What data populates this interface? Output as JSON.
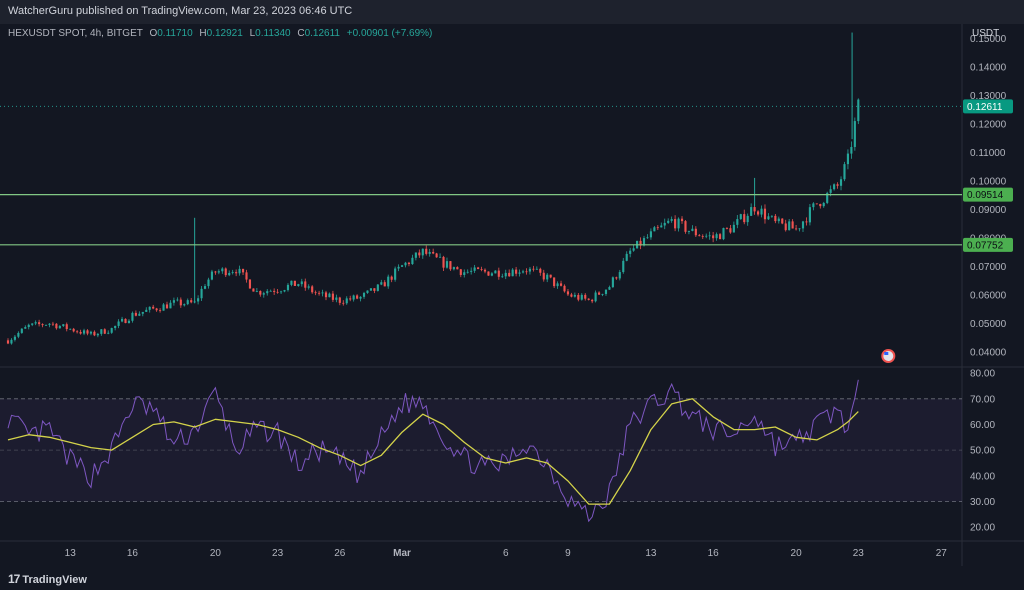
{
  "header": {
    "publisher": "WatcherGuru published on TradingView.com, Mar 23, 2023 06:46 UTC"
  },
  "legend": {
    "symbol": "HEXUSDT SPOT, 4h, BITGET",
    "open_label": "O",
    "open": "0.11710",
    "high_label": "H",
    "high": "0.12921",
    "low_label": "L",
    "low": "0.11340",
    "close_label": "C",
    "close": "0.12611",
    "change": "+0.00901 (+7.69%)"
  },
  "price_axis_unit": "USDT",
  "footer": {
    "brand": "TradingView",
    "logo_mark": "17"
  },
  "colors": {
    "up": "#26a69a",
    "down": "#ef5350",
    "level": "#81c784",
    "rsi": "#7e57c2",
    "rsi_ma": "#d4d34a",
    "bg": "#131722"
  },
  "chart_data": [
    {
      "type": "candlestick",
      "interval": "4h",
      "y_scale": "linear",
      "ylim": [
        0.035,
        0.155
      ],
      "y_ticks": [
        "0.15000",
        "0.14000",
        "0.13000",
        "0.12000",
        "0.11000",
        "0.10000",
        "0.09000",
        "0.08000",
        "0.07000",
        "0.06000",
        "0.05000",
        "0.04000"
      ],
      "x_ticks": [
        "13",
        "16",
        "20",
        "23",
        "26",
        "Mar",
        "6",
        "9",
        "13",
        "16",
        "20",
        "23",
        "27"
      ],
      "x_tick_dates": [
        "2023-02-13",
        "2023-02-16",
        "2023-02-20",
        "2023-02-23",
        "2023-02-26",
        "2023-03-01",
        "2023-03-06",
        "2023-03-09",
        "2023-03-13",
        "2023-03-16",
        "2023-03-20",
        "2023-03-23",
        "2023-03-27"
      ],
      "x_range": [
        "2023-02-10",
        "2023-03-28"
      ],
      "last_date": "2023-03-23",
      "current_price": 0.12611,
      "horizontal_levels": [
        0.09514,
        0.07752
      ],
      "price_labels": [
        "0.12611",
        "0.09514",
        "0.07752"
      ],
      "close_path": [
        [
          "2023-02-10",
          0.044
        ],
        [
          "2023-02-11",
          0.049
        ],
        [
          "2023-02-12",
          0.05
        ],
        [
          "2023-02-13",
          0.048
        ],
        [
          "2023-02-14",
          0.046
        ],
        [
          "2023-02-15",
          0.048
        ],
        [
          "2023-02-16",
          0.053
        ],
        [
          "2023-02-17",
          0.055
        ],
        [
          "2023-02-18",
          0.057
        ],
        [
          "2023-02-19",
          0.057
        ],
        [
          "2023-02-19.5",
          0.064
        ],
        [
          "2023-02-20",
          0.068
        ],
        [
          "2023-02-21",
          0.069
        ],
        [
          "2023-02-22",
          0.061
        ],
        [
          "2023-02-23",
          0.062
        ],
        [
          "2023-02-24",
          0.064
        ],
        [
          "2023-02-25",
          0.06
        ],
        [
          "2023-02-26",
          0.058
        ],
        [
          "2023-02-27",
          0.059
        ],
        [
          "2023-02-28",
          0.063
        ],
        [
          "2023-03-01",
          0.07
        ],
        [
          "2023-03-02",
          0.075
        ],
        [
          "2023-03-03",
          0.071
        ],
        [
          "2023-03-04",
          0.068
        ],
        [
          "2023-03-05",
          0.068
        ],
        [
          "2023-03-06",
          0.068
        ],
        [
          "2023-03-07",
          0.069
        ],
        [
          "2023-03-08",
          0.066
        ],
        [
          "2023-03-09",
          0.06
        ],
        [
          "2023-03-10",
          0.058
        ],
        [
          "2023-03-11",
          0.063
        ],
        [
          "2023-03-12",
          0.075
        ],
        [
          "2023-03-13",
          0.081
        ],
        [
          "2023-03-14",
          0.086
        ],
        [
          "2023-03-15",
          0.082
        ],
        [
          "2023-03-16",
          0.08
        ],
        [
          "2023-03-17",
          0.084
        ],
        [
          "2023-03-18",
          0.091
        ],
        [
          "2023-03-19",
          0.085
        ],
        [
          "2023-03-20",
          0.083
        ],
        [
          "2023-03-21",
          0.092
        ],
        [
          "2023-03-22",
          0.098
        ],
        [
          "2023-03-22.5",
          0.107
        ],
        [
          "2023-03-23",
          0.126
        ]
      ],
      "notable_wicks": [
        [
          "2023-02-19",
          0.087
        ],
        [
          "2023-03-18",
          0.101
        ],
        [
          "2023-03-22.7",
          0.152
        ]
      ]
    },
    {
      "type": "line",
      "indicator": "RSI",
      "ylim": [
        15,
        82
      ],
      "y_ticks": [
        "80.00",
        "70.00",
        "60.00",
        "50.00",
        "40.00",
        "30.00",
        "20.00"
      ],
      "band": [
        30,
        70
      ],
      "midline": 50,
      "series": [
        {
          "role": "rsi",
          "points": [
            [
              "2023-02-10",
              63
            ],
            [
              "2023-02-11",
              55
            ],
            [
              "2023-02-12",
              58
            ],
            [
              "2023-02-13",
              46
            ],
            [
              "2023-02-14",
              40
            ],
            [
              "2023-02-15",
              50
            ],
            [
              "2023-02-16",
              68
            ],
            [
              "2023-02-17",
              66
            ],
            [
              "2023-02-18",
              52
            ],
            [
              "2023-02-19",
              58
            ],
            [
              "2023-02-20",
              72
            ],
            [
              "2023-02-21",
              50
            ],
            [
              "2023-02-22",
              58
            ],
            [
              "2023-02-23",
              57
            ],
            [
              "2023-02-24",
              44
            ],
            [
              "2023-02-25",
              50
            ],
            [
              "2023-02-26",
              46
            ],
            [
              "2023-02-27",
              40
            ],
            [
              "2023-02-28",
              55
            ],
            [
              "2023-03-01",
              68
            ],
            [
              "2023-03-02",
              69
            ],
            [
              "2023-03-03",
              55
            ],
            [
              "2023-03-04",
              47
            ],
            [
              "2023-03-05",
              43
            ],
            [
              "2023-03-06",
              45
            ],
            [
              "2023-03-07",
              53
            ],
            [
              "2023-03-08",
              45
            ],
            [
              "2023-03-09",
              32
            ],
            [
              "2023-03-10",
              24
            ],
            [
              "2023-03-11",
              33
            ],
            [
              "2023-03-12",
              60
            ],
            [
              "2023-03-13",
              68
            ],
            [
              "2023-03-14",
              73
            ],
            [
              "2023-03-15",
              63
            ],
            [
              "2023-03-16",
              58
            ],
            [
              "2023-03-17",
              56
            ],
            [
              "2023-03-18",
              64
            ],
            [
              "2023-03-19",
              52
            ],
            [
              "2023-03-20",
              53
            ],
            [
              "2023-03-21",
              60
            ],
            [
              "2023-03-22",
              66
            ],
            [
              "2023-03-22.5",
              58
            ],
            [
              "2023-03-23",
              73
            ]
          ]
        },
        {
          "role": "rsi-ma",
          "points": [
            [
              "2023-02-10",
              54
            ],
            [
              "2023-02-11",
              56
            ],
            [
              "2023-02-12",
              55
            ],
            [
              "2023-02-13",
              53
            ],
            [
              "2023-02-14",
              51
            ],
            [
              "2023-02-15",
              50
            ],
            [
              "2023-02-16",
              55
            ],
            [
              "2023-02-17",
              60
            ],
            [
              "2023-02-18",
              61
            ],
            [
              "2023-02-19",
              59
            ],
            [
              "2023-02-20",
              62
            ],
            [
              "2023-02-21",
              61
            ],
            [
              "2023-02-22",
              60
            ],
            [
              "2023-02-23",
              58
            ],
            [
              "2023-02-24",
              55
            ],
            [
              "2023-02-25",
              51
            ],
            [
              "2023-02-26",
              48
            ],
            [
              "2023-02-27",
              44
            ],
            [
              "2023-02-28",
              48
            ],
            [
              "2023-03-01",
              57
            ],
            [
              "2023-03-02",
              64
            ],
            [
              "2023-03-03",
              60
            ],
            [
              "2023-03-04",
              53
            ],
            [
              "2023-03-05",
              47
            ],
            [
              "2023-03-06",
              45
            ],
            [
              "2023-03-07",
              47
            ],
            [
              "2023-03-08",
              45
            ],
            [
              "2023-03-09",
              38
            ],
            [
              "2023-03-10",
              29
            ],
            [
              "2023-03-11",
              29
            ],
            [
              "2023-03-12",
              42
            ],
            [
              "2023-03-13",
              58
            ],
            [
              "2023-03-14",
              68
            ],
            [
              "2023-03-15",
              70
            ],
            [
              "2023-03-16",
              63
            ],
            [
              "2023-03-17",
              58
            ],
            [
              "2023-03-18",
              58
            ],
            [
              "2023-03-19",
              59
            ],
            [
              "2023-03-20",
              55
            ],
            [
              "2023-03-21",
              54
            ],
            [
              "2023-03-22",
              58
            ],
            [
              "2023-03-22.5",
              61
            ],
            [
              "2023-03-23",
              65
            ]
          ]
        }
      ]
    }
  ]
}
